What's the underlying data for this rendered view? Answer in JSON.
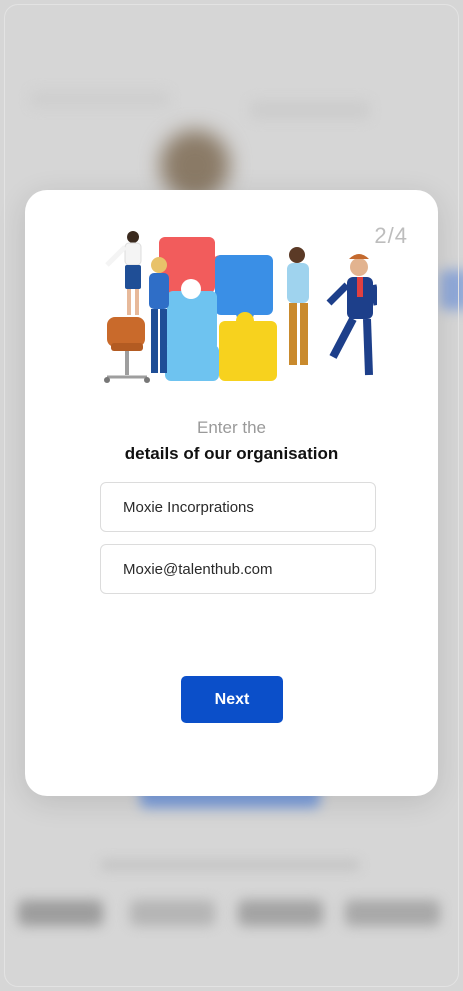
{
  "modal": {
    "step_indicator": "2/4",
    "heading_sub": "Enter the",
    "heading_main": "details of our organisation",
    "fields": {
      "organisation_name": "Moxie Incorprations",
      "email": "Moxie@talenthub.com"
    },
    "next_label": "Next"
  },
  "colors": {
    "primary": "#0b4fc9",
    "overlay": "#d6d6d6",
    "puzzle_red": "#f25c5c",
    "puzzle_blue": "#3a8fe6",
    "puzzle_yellow": "#f7d21e",
    "puzzle_light_blue": "#6ec3f0"
  },
  "icons": [
    "team-puzzle-illustration"
  ]
}
